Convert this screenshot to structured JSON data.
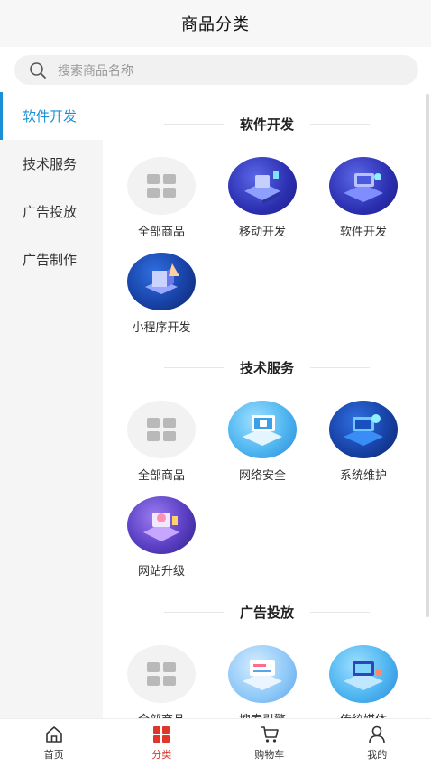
{
  "header": {
    "title": "商品分类"
  },
  "search": {
    "placeholder": "搜索商品名称"
  },
  "sidebar": {
    "items": [
      {
        "label": "软件开发",
        "active": true
      },
      {
        "label": "技术服务",
        "active": false
      },
      {
        "label": "广告投放",
        "active": false
      },
      {
        "label": "广告制作",
        "active": false
      }
    ]
  },
  "sections": [
    {
      "title": "软件开发",
      "items": [
        {
          "label": "全部商品",
          "icon": "grid-icon"
        },
        {
          "label": "移动开发",
          "icon": "mobile-dev-illustration"
        },
        {
          "label": "软件开发",
          "icon": "software-dev-illustration"
        },
        {
          "label": "小程序开发",
          "icon": "mini-program-illustration"
        }
      ]
    },
    {
      "title": "技术服务",
      "items": [
        {
          "label": "全部商品",
          "icon": "grid-icon"
        },
        {
          "label": "网络安全",
          "icon": "network-security-illustration"
        },
        {
          "label": "系统维护",
          "icon": "system-maintenance-illustration"
        },
        {
          "label": "网站升级",
          "icon": "website-upgrade-illustration"
        }
      ]
    },
    {
      "title": "广告投放",
      "items": [
        {
          "label": "全部商品",
          "icon": "grid-icon"
        },
        {
          "label": "搜索引擎",
          "icon": "search-engine-illustration"
        },
        {
          "label": "传统媒体",
          "icon": "traditional-media-illustration"
        }
      ]
    }
  ],
  "tabbar": {
    "items": [
      {
        "label": "首页",
        "icon": "home-icon"
      },
      {
        "label": "分类",
        "icon": "category-icon",
        "active": true
      },
      {
        "label": "购物车",
        "icon": "cart-icon"
      },
      {
        "label": "我的",
        "icon": "user-icon"
      }
    ]
  },
  "colors": {
    "accent": "#1a8fd6",
    "tab_active": "#e0352b"
  }
}
